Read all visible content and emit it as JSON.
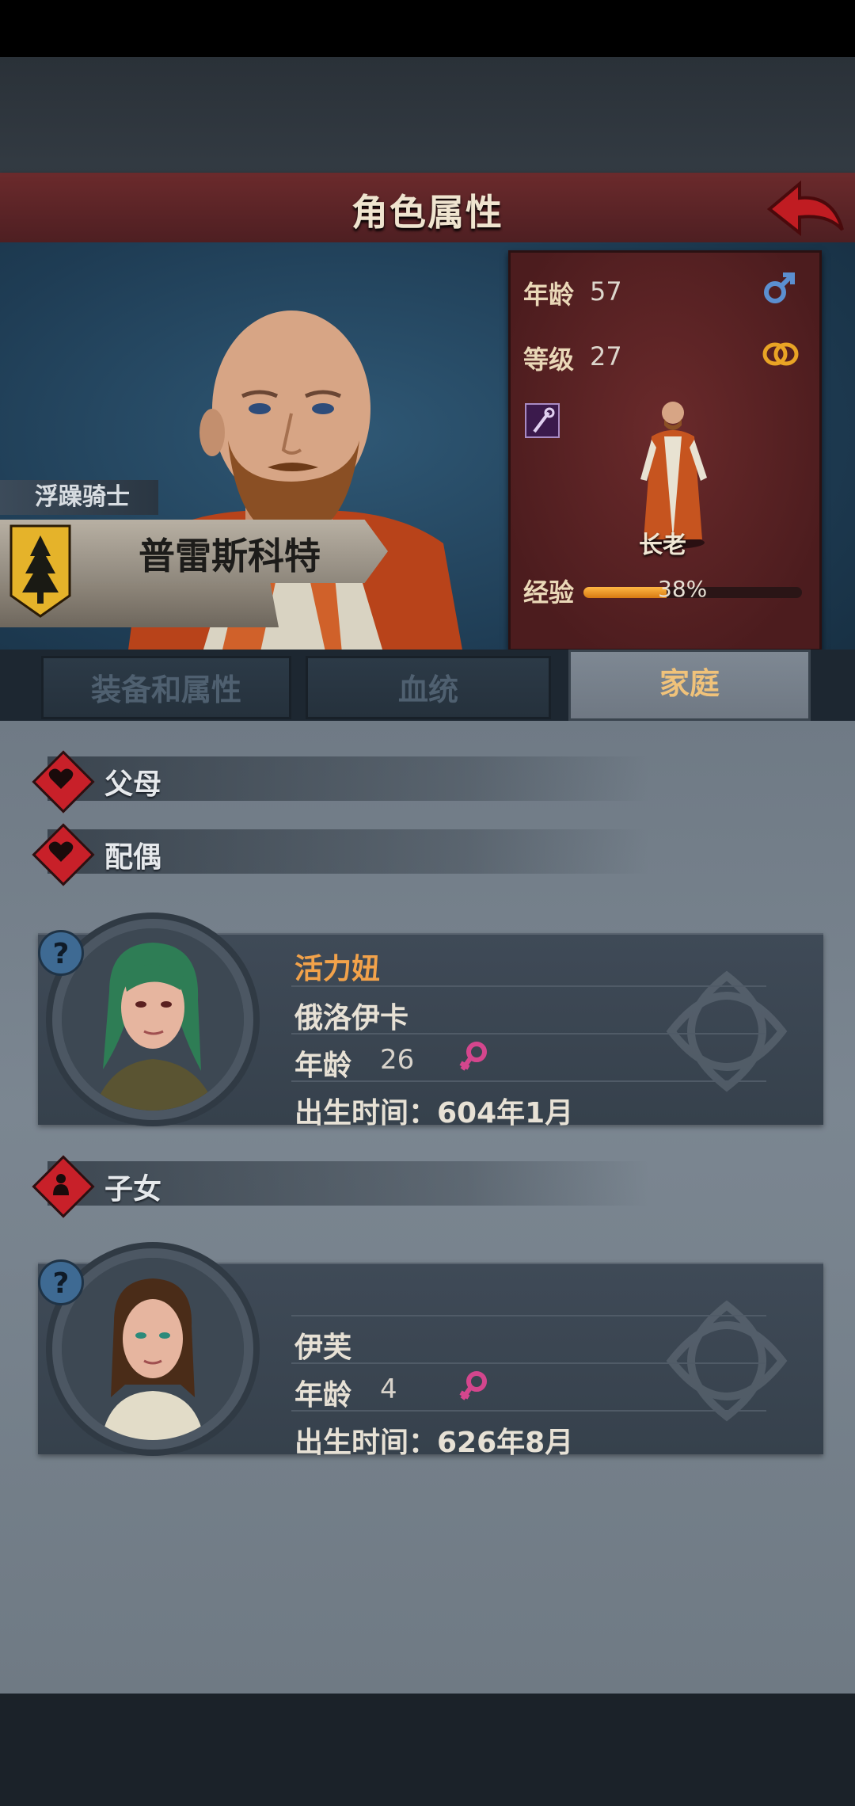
{
  "header": {
    "title": "角色属性"
  },
  "character": {
    "title": "浮躁骑士",
    "name": "普雷斯科特",
    "stats": {
      "age_label": "年龄",
      "age": "57",
      "level_label": "等级",
      "level": "27",
      "class_name": "长老",
      "exp_label": "经验",
      "exp_text": "38%",
      "exp_fraction": 0.38
    }
  },
  "tabs": [
    {
      "label": "装备和属性"
    },
    {
      "label": "血统"
    },
    {
      "label": "家庭"
    }
  ],
  "sections": {
    "parents": "父母",
    "spouse": "配偶",
    "children": "子女"
  },
  "spouse": {
    "help": "?",
    "nickname": "活力妞",
    "name": "俄洛伊卡",
    "age_label": "年龄",
    "age": "26",
    "birth": "出生时间：604年1月"
  },
  "child": {
    "help": "?",
    "name": "伊芙",
    "age_label": "年龄",
    "age": "4",
    "birth": "出生时间：626年8月"
  },
  "colors": {
    "accent_red": "#c82029",
    "tab_active_text": "#f0c27a",
    "nickname": "#f2a24a",
    "female_icon": "#d4468d",
    "male_icon": "#5b8fd0"
  }
}
